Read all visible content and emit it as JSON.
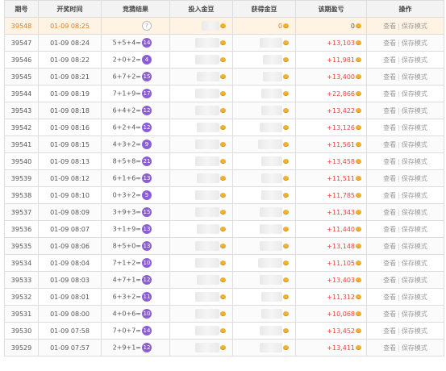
{
  "columns": [
    "期号",
    "开奖时间",
    "竞猜结果",
    "投入金豆",
    "获得金豆",
    "该期盈亏",
    "操作"
  ],
  "ops": {
    "view": "查看",
    "save_mode": "保存模式",
    "separator": "|"
  },
  "colors": {
    "ball": "#8a5fd3",
    "profit": "#e8453c",
    "current_row": "#fff4e3",
    "coin": "#f0b030"
  },
  "rows": [
    {
      "issue": "39548",
      "time": "01-09 08:25",
      "expr": "",
      "result": "?",
      "win": "0",
      "profit": "0",
      "current": true
    },
    {
      "issue": "39547",
      "time": "01-09 08:24",
      "expr": "5+5+4=",
      "result": "14",
      "win": "",
      "profit": "+13,103"
    },
    {
      "issue": "39546",
      "time": "01-09 08:22",
      "expr": "2+0+2=",
      "result": "4",
      "win": "",
      "profit": "+11,981"
    },
    {
      "issue": "39545",
      "time": "01-09 08:21",
      "expr": "6+7+2=",
      "result": "15",
      "win": "",
      "profit": "+13,400"
    },
    {
      "issue": "39544",
      "time": "01-09 08:19",
      "expr": "7+1+9=",
      "result": "17",
      "win": "",
      "profit": "+22,866"
    },
    {
      "issue": "39543",
      "time": "01-09 08:18",
      "expr": "6+4+2=",
      "result": "12",
      "win": "",
      "profit": "+13,422"
    },
    {
      "issue": "39542",
      "time": "01-09 08:16",
      "expr": "6+2+4=",
      "result": "12",
      "win": "",
      "profit": "+13,126"
    },
    {
      "issue": "39541",
      "time": "01-09 08:15",
      "expr": "4+3+2=",
      "result": "9",
      "win": "",
      "profit": "+11,561"
    },
    {
      "issue": "39540",
      "time": "01-09 08:13",
      "expr": "8+5+8=",
      "result": "21",
      "win": "",
      "profit": "+13,458"
    },
    {
      "issue": "39539",
      "time": "01-09 08:12",
      "expr": "6+1+6=",
      "result": "13",
      "win": "",
      "profit": "+11,511"
    },
    {
      "issue": "39538",
      "time": "01-09 08:10",
      "expr": "0+3+2=",
      "result": "5",
      "win": "",
      "profit": "+11,785"
    },
    {
      "issue": "39537",
      "time": "01-09 08:09",
      "expr": "3+9+3=",
      "result": "15",
      "win": "",
      "profit": "+11,343"
    },
    {
      "issue": "39536",
      "time": "01-09 08:07",
      "expr": "3+1+9=",
      "result": "13",
      "win": "",
      "profit": "+11,440"
    },
    {
      "issue": "39535",
      "time": "01-09 08:06",
      "expr": "8+5+0=",
      "result": "13",
      "win": "",
      "profit": "+13,148"
    },
    {
      "issue": "39534",
      "time": "01-09 08:04",
      "expr": "7+1+2=",
      "result": "10",
      "win": "",
      "profit": "+11,105"
    },
    {
      "issue": "39533",
      "time": "01-09 08:03",
      "expr": "4+7+1=",
      "result": "12",
      "win": "",
      "profit": "+13,403"
    },
    {
      "issue": "39532",
      "time": "01-09 08:01",
      "expr": "6+3+2=",
      "result": "11",
      "win": "",
      "profit": "+11,312"
    },
    {
      "issue": "39531",
      "time": "01-09 08:00",
      "expr": "4+0+6=",
      "result": "10",
      "win": "",
      "profit": "+10,068"
    },
    {
      "issue": "39530",
      "time": "01-09 07:58",
      "expr": "7+0+7=",
      "result": "14",
      "win": "",
      "profit": "+13,452"
    },
    {
      "issue": "39529",
      "time": "01-09 07:57",
      "expr": "2+9+1=",
      "result": "12",
      "win": "",
      "profit": "+13,411"
    }
  ]
}
